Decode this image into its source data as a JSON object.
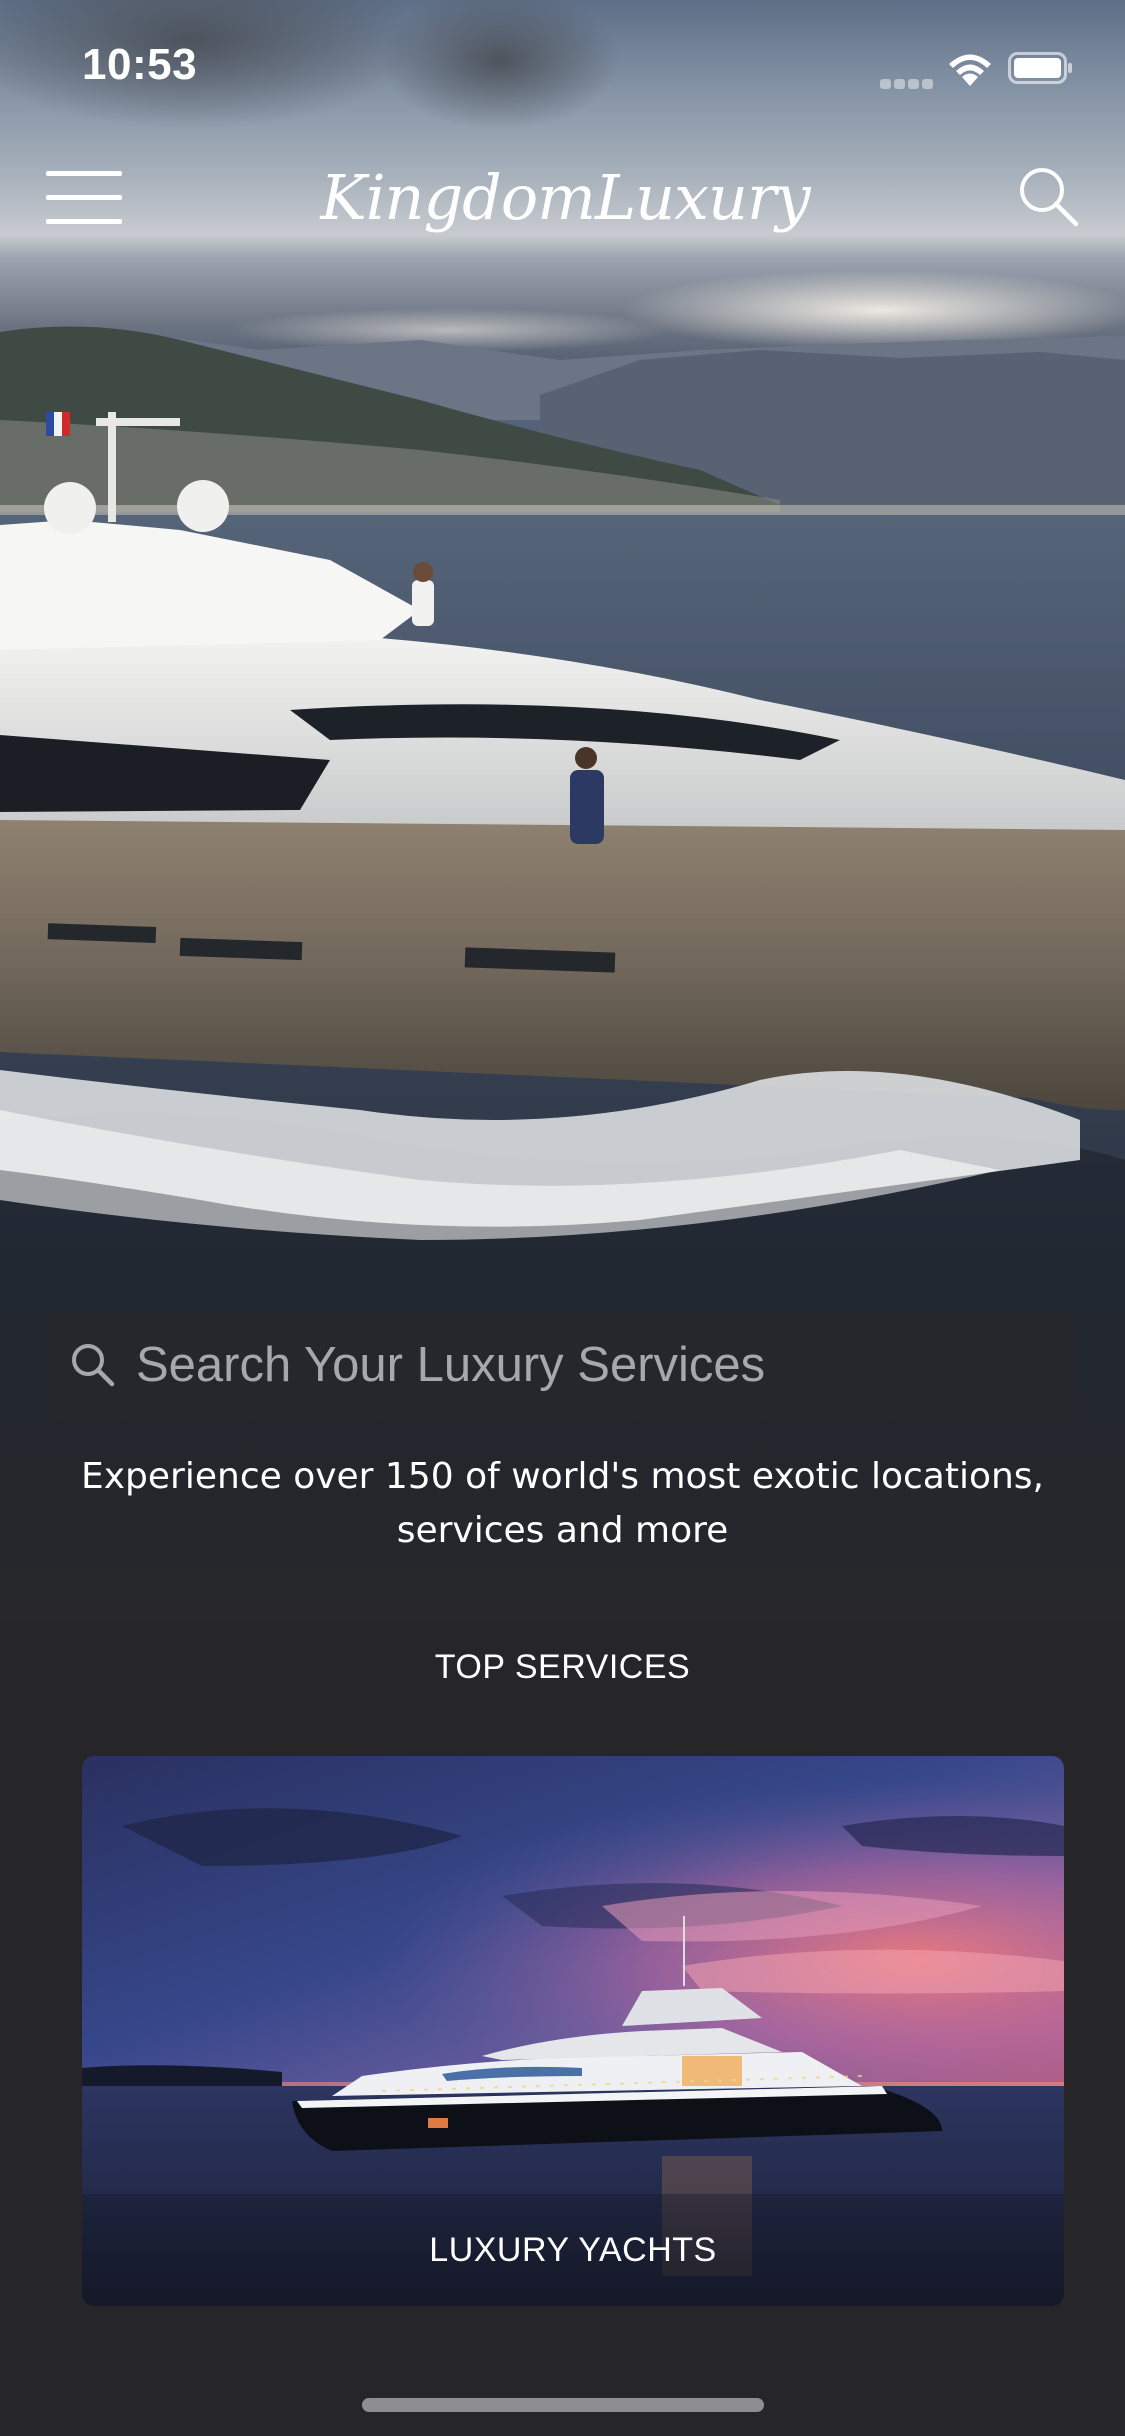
{
  "status_bar": {
    "time": "10:53",
    "wifi_icon": "wifi-icon",
    "battery_icon": "battery-icon"
  },
  "nav": {
    "menu_icon": "hamburger-menu-icon",
    "brand": "KingdomLuxury",
    "search_icon": "search-icon"
  },
  "hero": {
    "image": "yacht-at-sea-photo",
    "search_placeholder": "Search Your Luxury Services",
    "tagline": "Experience over 150 of world's most exotic locations, services and more"
  },
  "top_services": {
    "title": "TOP SERVICES",
    "cards": [
      {
        "label": "LUXURY YACHTS",
        "image": "yacht-at-dusk-photo"
      }
    ]
  },
  "colors": {
    "background": "#262628",
    "text": "#ffffff",
    "placeholder": "#a7a8ab"
  }
}
